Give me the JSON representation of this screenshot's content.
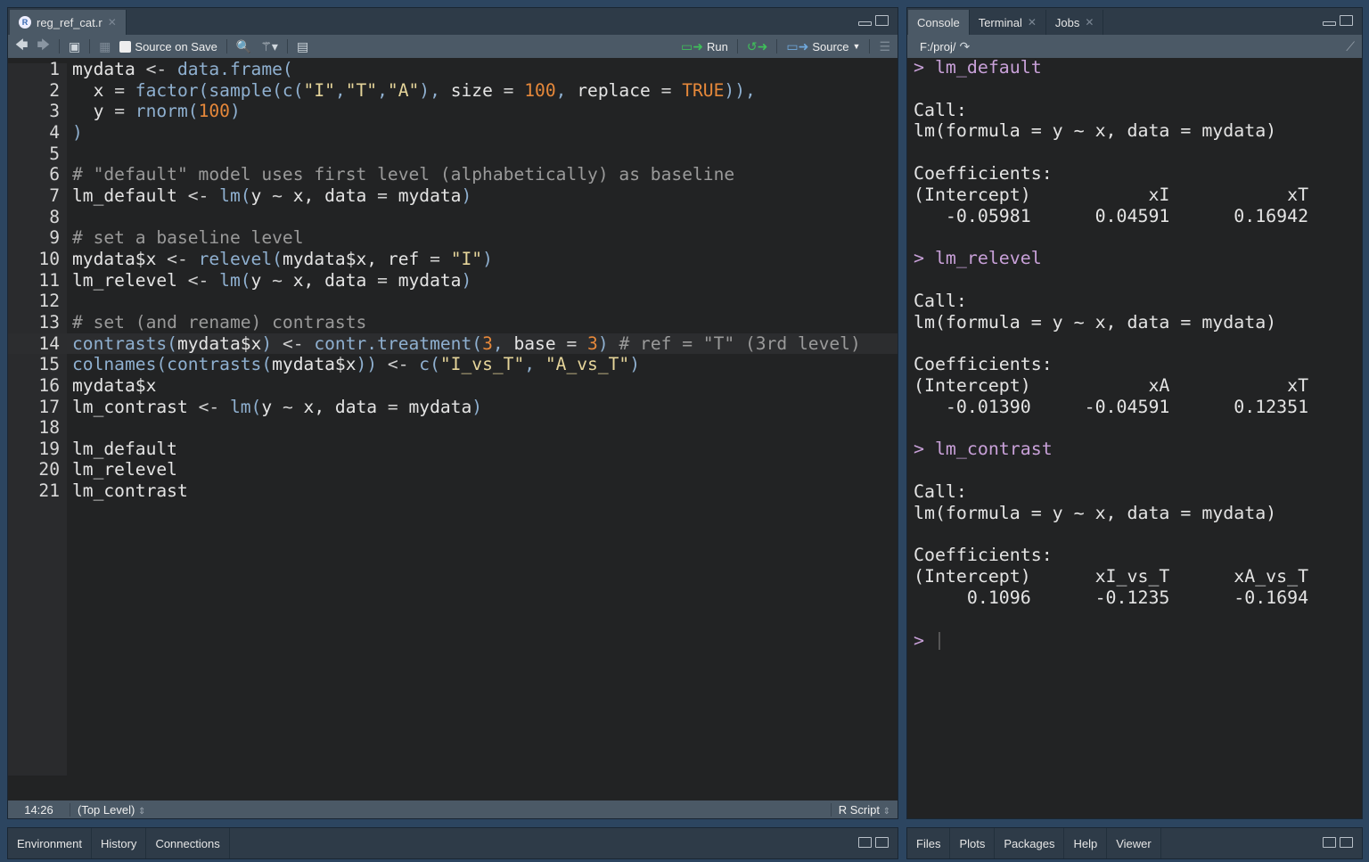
{
  "editor": {
    "tab_label": "reg_ref_cat.r",
    "toolbar": {
      "source_on_save": "Source on Save",
      "run": "Run",
      "source": "Source"
    },
    "lines": [
      [
        [
          "p",
          "mydata "
        ],
        [
          "o",
          "<- "
        ],
        [
          "f",
          "data.frame("
        ]
      ],
      [
        [
          "p",
          "  x "
        ],
        [
          "o",
          "= "
        ],
        [
          "f",
          "factor(sample(c("
        ],
        [
          "s",
          "\"I\""
        ],
        [
          "f",
          ","
        ],
        [
          "s",
          "\"T\""
        ],
        [
          "f",
          ","
        ],
        [
          "s",
          "\"A\""
        ],
        [
          "f",
          "), "
        ],
        [
          "p",
          "size "
        ],
        [
          "o",
          "= "
        ],
        [
          "n",
          "100"
        ],
        [
          "f",
          ", "
        ],
        [
          "p",
          "replace "
        ],
        [
          "o",
          "= "
        ],
        [
          "n",
          "TRUE"
        ],
        [
          "f",
          ")),"
        ]
      ],
      [
        [
          "p",
          "  y "
        ],
        [
          "o",
          "= "
        ],
        [
          "f",
          "rnorm("
        ],
        [
          "n",
          "100"
        ],
        [
          "f",
          ")"
        ]
      ],
      [
        [
          "f",
          ")"
        ]
      ],
      [],
      [
        [
          "c",
          "# \"default\" model uses first level (alphabetically) as baseline"
        ]
      ],
      [
        [
          "p",
          "lm_default "
        ],
        [
          "o",
          "<- "
        ],
        [
          "f",
          "lm("
        ],
        [
          "p",
          "y "
        ],
        [
          "o",
          "~ "
        ],
        [
          "p",
          "x, data "
        ],
        [
          "o",
          "= "
        ],
        [
          "p",
          "mydata"
        ],
        [
          "f",
          ")"
        ]
      ],
      [],
      [
        [
          "c",
          "# set a baseline level"
        ]
      ],
      [
        [
          "p",
          "mydata$x "
        ],
        [
          "o",
          "<- "
        ],
        [
          "f",
          "relevel("
        ],
        [
          "p",
          "mydata$x, ref "
        ],
        [
          "o",
          "= "
        ],
        [
          "s",
          "\"I\""
        ],
        [
          "f",
          ")"
        ]
      ],
      [
        [
          "p",
          "lm_relevel "
        ],
        [
          "o",
          "<- "
        ],
        [
          "f",
          "lm("
        ],
        [
          "p",
          "y "
        ],
        [
          "o",
          "~ "
        ],
        [
          "p",
          "x, data "
        ],
        [
          "o",
          "= "
        ],
        [
          "p",
          "mydata"
        ],
        [
          "f",
          ")"
        ]
      ],
      [],
      [
        [
          "c",
          "# set (and rename) contrasts"
        ]
      ],
      [
        [
          "f",
          "contrasts("
        ],
        [
          "p",
          "mydata$x"
        ],
        [
          "f",
          ") "
        ],
        [
          "o",
          "<- "
        ],
        [
          "f",
          "contr.treatment("
        ],
        [
          "n",
          "3"
        ],
        [
          "f",
          ", "
        ],
        [
          "p",
          "base "
        ],
        [
          "o",
          "= "
        ],
        [
          "n",
          "3"
        ],
        [
          "f",
          ") "
        ],
        [
          "c",
          "# ref = \"T\" (3rd level)"
        ]
      ],
      [
        [
          "f",
          "colnames(contrasts("
        ],
        [
          "p",
          "mydata$x"
        ],
        [
          "f",
          ")) "
        ],
        [
          "o",
          "<- "
        ],
        [
          "f",
          "c("
        ],
        [
          "s",
          "\"I_vs_T\""
        ],
        [
          "f",
          ", "
        ],
        [
          "s",
          "\"A_vs_T\""
        ],
        [
          "f",
          ")"
        ]
      ],
      [
        [
          "p",
          "mydata$x"
        ]
      ],
      [
        [
          "p",
          "lm_contrast "
        ],
        [
          "o",
          "<- "
        ],
        [
          "f",
          "lm("
        ],
        [
          "p",
          "y "
        ],
        [
          "o",
          "~ "
        ],
        [
          "p",
          "x, data "
        ],
        [
          "o",
          "= "
        ],
        [
          "p",
          "mydata"
        ],
        [
          "f",
          ")"
        ]
      ],
      [],
      [
        [
          "p",
          "lm_default"
        ]
      ],
      [
        [
          "p",
          "lm_relevel"
        ]
      ],
      [
        [
          "p",
          "lm_contrast"
        ]
      ]
    ],
    "status": {
      "position": "14:26",
      "scope": "(Top Level)",
      "filetype": "R Script"
    }
  },
  "console": {
    "tabs": [
      "Console",
      "Terminal",
      "Jobs"
    ],
    "path": "F:/proj/",
    "lines": [
      [
        "prompt",
        "> lm_default"
      ],
      [
        "con",
        ""
      ],
      [
        "con",
        "Call:"
      ],
      [
        "con",
        "lm(formula = y ~ x, data = mydata)"
      ],
      [
        "con",
        ""
      ],
      [
        "con",
        "Coefficients:"
      ],
      [
        "con",
        "(Intercept)           xI           xT  "
      ],
      [
        "con",
        "   -0.05981      0.04591      0.16942  "
      ],
      [
        "con",
        ""
      ],
      [
        "prompt",
        "> lm_relevel"
      ],
      [
        "con",
        ""
      ],
      [
        "con",
        "Call:"
      ],
      [
        "con",
        "lm(formula = y ~ x, data = mydata)"
      ],
      [
        "con",
        ""
      ],
      [
        "con",
        "Coefficients:"
      ],
      [
        "con",
        "(Intercept)           xA           xT  "
      ],
      [
        "con",
        "   -0.01390     -0.04591      0.12351  "
      ],
      [
        "con",
        ""
      ],
      [
        "prompt",
        "> lm_contrast"
      ],
      [
        "con",
        ""
      ],
      [
        "con",
        "Call:"
      ],
      [
        "con",
        "lm(formula = y ~ x, data = mydata)"
      ],
      [
        "con",
        ""
      ],
      [
        "con",
        "Coefficients:"
      ],
      [
        "con",
        "(Intercept)      xI_vs_T      xA_vs_T  "
      ],
      [
        "con",
        "     0.1096      -0.1235      -0.1694  "
      ],
      [
        "con",
        ""
      ],
      [
        "prompt",
        "> "
      ]
    ]
  },
  "bottom_left_tabs": [
    "Environment",
    "History",
    "Connections"
  ],
  "bottom_right_tabs": [
    "Files",
    "Plots",
    "Packages",
    "Help",
    "Viewer"
  ]
}
